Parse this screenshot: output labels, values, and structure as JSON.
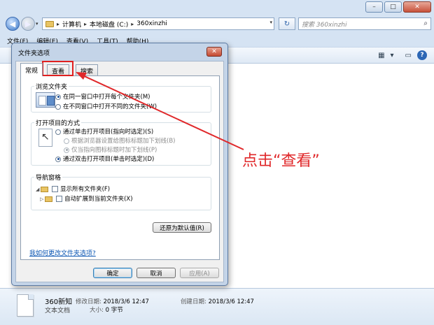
{
  "window": {
    "minimize_glyph": "–",
    "maximize_glyph": "□",
    "close_glyph": "✕"
  },
  "nav": {
    "back_glyph": "◀",
    "forward_glyph": "▶",
    "address_parts": [
      "计算机",
      "本地磁盘 (C:)",
      "360xinzhi"
    ],
    "separator": "▸",
    "refresh_glyph": "↻",
    "search_placeholder": "搜索 360xinzhi",
    "search_glyph": "⌕"
  },
  "menubar": {
    "items": [
      "文件(F)",
      "编辑(E)",
      "查看(V)",
      "工具(T)",
      "帮助(H)"
    ]
  },
  "toolbar": {
    "icons": [
      "view-icon",
      "dropdown-icon",
      "preview-pane-icon",
      "help-icon"
    ],
    "view_glyph": "▦",
    "dropdown_glyph": "▾",
    "preview_glyph": "▭",
    "help_glyph": "?"
  },
  "dialog": {
    "title": "文件夹选项",
    "close_glyph": "✕",
    "tabs": [
      "常规",
      "查看",
      "搜索"
    ],
    "browse_group": {
      "title": "浏览文件夹",
      "options": [
        "在同一窗口中打开每个文件夹(M)",
        "在不同窗口中打开不同的文件夹(W)"
      ]
    },
    "click_group": {
      "title": "打开项目的方式",
      "options": [
        "通过单击打开项目(指向时选定)(S)",
        "根据浏览器设置给图标标题加下划线(B)",
        "仅当指向图标标题时加下划线(P)",
        "通过双击打开项目(单击时选定)(D)"
      ]
    },
    "nav_group": {
      "title": "导航窗格",
      "options": [
        "显示所有文件夹(F)",
        "自动扩展到当前文件夹(X)"
      ]
    },
    "restore_button": "还原为默认值(R)",
    "help_link": "我如何更改文件夹选项?",
    "ok_button": "确定",
    "cancel_button": "取消",
    "apply_button": "应用(A)"
  },
  "details": {
    "name": "360新知",
    "type": "文本文档",
    "modified_label": "修改日期:",
    "modified_value": "2018/3/6 12:47",
    "size_label": "大小:",
    "size_value": "0 字节",
    "created_label": "创建日期:",
    "created_value": "2018/3/6 12:47"
  },
  "annotation": {
    "callout_text": "点击“查看”",
    "color": "#e0282a"
  }
}
